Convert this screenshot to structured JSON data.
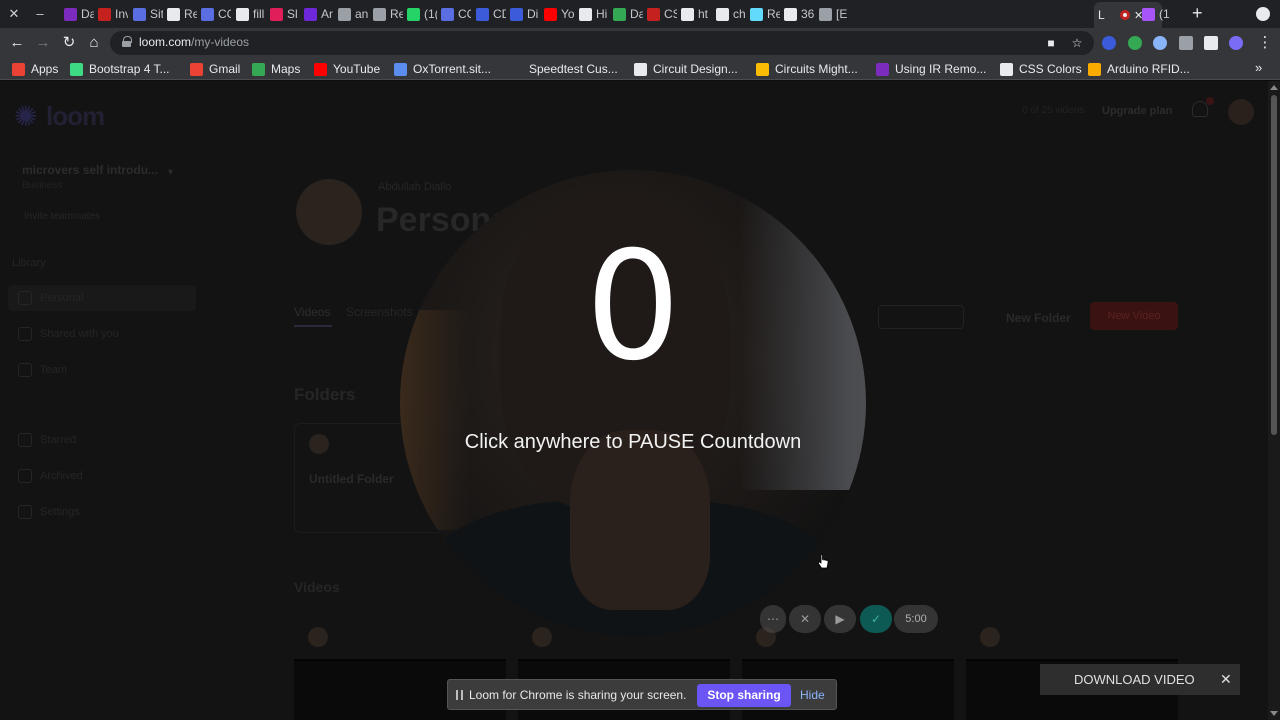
{
  "browser": {
    "tabs": [
      {
        "title": "Da",
        "color": "#7b2cbf"
      },
      {
        "title": "Inv",
        "color": "#c5221f"
      },
      {
        "title": "Sit",
        "color": "#5b6ee1"
      },
      {
        "title": "Re",
        "color": "#e8eaed"
      },
      {
        "title": "CC",
        "color": "#5b6ee1"
      },
      {
        "title": "fill",
        "color": "#e8eaed"
      },
      {
        "title": "Sl",
        "color": "#e01e5a"
      },
      {
        "title": "Ar",
        "color": "#6d28d9"
      },
      {
        "title": "an",
        "color": "#9aa0a6"
      },
      {
        "title": "Re",
        "color": "#9aa0a6"
      },
      {
        "title": "(1(",
        "color": "#25d366"
      },
      {
        "title": "CC",
        "color": "#5b6ee1"
      },
      {
        "title": "CD",
        "color": "#3b5bdb"
      },
      {
        "title": "Di",
        "color": "#3b5bdb"
      },
      {
        "title": "Yo",
        "color": "#ff0000"
      },
      {
        "title": "Hi",
        "color": "#e8eaed"
      },
      {
        "title": "Da",
        "color": "#34a853"
      },
      {
        "title": "CS",
        "color": "#c5221f"
      },
      {
        "title": "ht",
        "color": "#e8eaed"
      },
      {
        "title": "ch",
        "color": "#e8eaed"
      },
      {
        "title": "Re",
        "color": "#61dafb"
      },
      {
        "title": "36",
        "color": "#e8eaed"
      },
      {
        "title": "[E",
        "color": "#9aa0a6"
      }
    ],
    "active_tab": {
      "title": "L",
      "color": "#e8eaed"
    },
    "last_tab": {
      "title": "(1",
      "color": "#a855f7"
    },
    "url_host": "loom.com",
    "url_path": "/my-videos"
  },
  "bookmarks": [
    {
      "label": "Apps",
      "color": "#ea4335"
    },
    {
      "label": "Bootstrap 4 T...",
      "color": "#3ddc84"
    },
    {
      "label": "Gmail",
      "color": "#ea4335"
    },
    {
      "label": "Maps",
      "color": "#34a853"
    },
    {
      "label": "YouTube",
      "color": "#ff0000"
    },
    {
      "label": "OxTorrent.sit...",
      "color": "#5b8def"
    },
    {
      "label": "Speedtest Cus...",
      "color": "#35363a"
    },
    {
      "label": "Circuit Design...",
      "color": "#e8eaed"
    },
    {
      "label": "Circuits Might...",
      "color": "#fbbc05"
    },
    {
      "label": "Using IR Remo...",
      "color": "#7b2cbf"
    },
    {
      "label": "CSS Colors",
      "color": "#e8eaed"
    },
    {
      "label": "Arduino RFID...",
      "color": "#f9ab00"
    }
  ],
  "loom": {
    "logo": "loom",
    "workspace": "microvers self introdu...",
    "workspace_sub": "Business",
    "invite": "Invite teammates",
    "library_heading": "Library",
    "sidebar": [
      "Personal",
      "Shared with you",
      "Team",
      "Starred",
      "Archived",
      "Settings"
    ],
    "topright_a": "0 of 25 videos",
    "topright_b": "Upgrade plan",
    "owner": "Abdullah Diallo",
    "title": "Personal",
    "tabs": [
      "Videos",
      "Screenshots"
    ],
    "new_folder": "New Folder",
    "new_video": "New Video",
    "folders_heading": "Folders",
    "folder_name": "Untitled Folder",
    "videos_heading": "Videos"
  },
  "countdown": {
    "number": "0",
    "message": "Click anywhere to PAUSE Countdown"
  },
  "controls": {
    "timer": "5:00"
  },
  "share_bar": {
    "message": "Loom for Chrome is sharing your screen.",
    "stop": "Stop sharing",
    "hide": "Hide"
  },
  "download": {
    "label": "DOWNLOAD VIDEO"
  }
}
